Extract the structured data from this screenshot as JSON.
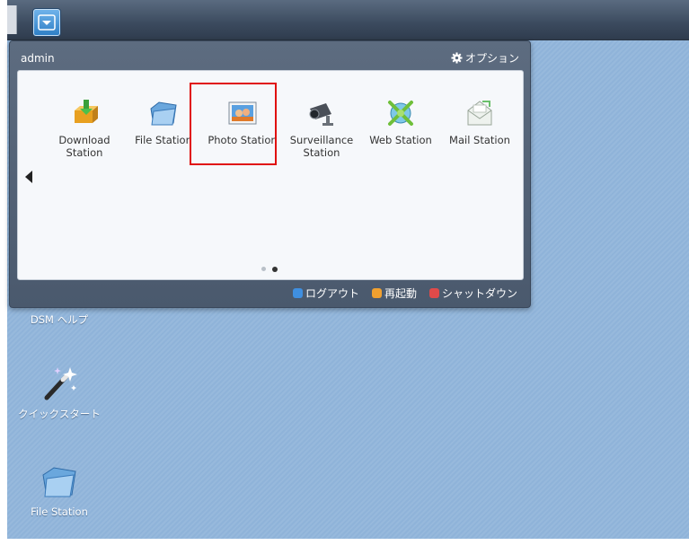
{
  "menu": {
    "user": "admin",
    "options_label": "オプション",
    "apps": [
      {
        "label": "Download Station",
        "icon": "download-station-icon"
      },
      {
        "label": "File Station",
        "icon": "file-station-icon"
      },
      {
        "label": "Photo Station",
        "icon": "photo-station-icon"
      },
      {
        "label": "Surveillance Station",
        "icon": "surveillance-station-icon"
      },
      {
        "label": "Web Station",
        "icon": "web-station-icon"
      },
      {
        "label": "Mail Station",
        "icon": "mail-station-icon"
      }
    ],
    "selected_app": "Photo Station",
    "page_dots": 2,
    "active_page": 2,
    "footer": {
      "logout": "ログアウト",
      "restart": "再起動",
      "shutdown": "シャットダウン"
    },
    "colors": {
      "logout": "#3f8fe0",
      "restart": "#f0a030",
      "shutdown": "#e04a4a",
      "highlight": "#e01010"
    }
  },
  "desktop": {
    "icons": [
      {
        "label": "DSM ヘルプ",
        "icon": "help-icon"
      },
      {
        "label": "クイックスタート",
        "icon": "magic-wand-icon"
      },
      {
        "label": "File Station",
        "icon": "file-station-icon"
      }
    ]
  }
}
